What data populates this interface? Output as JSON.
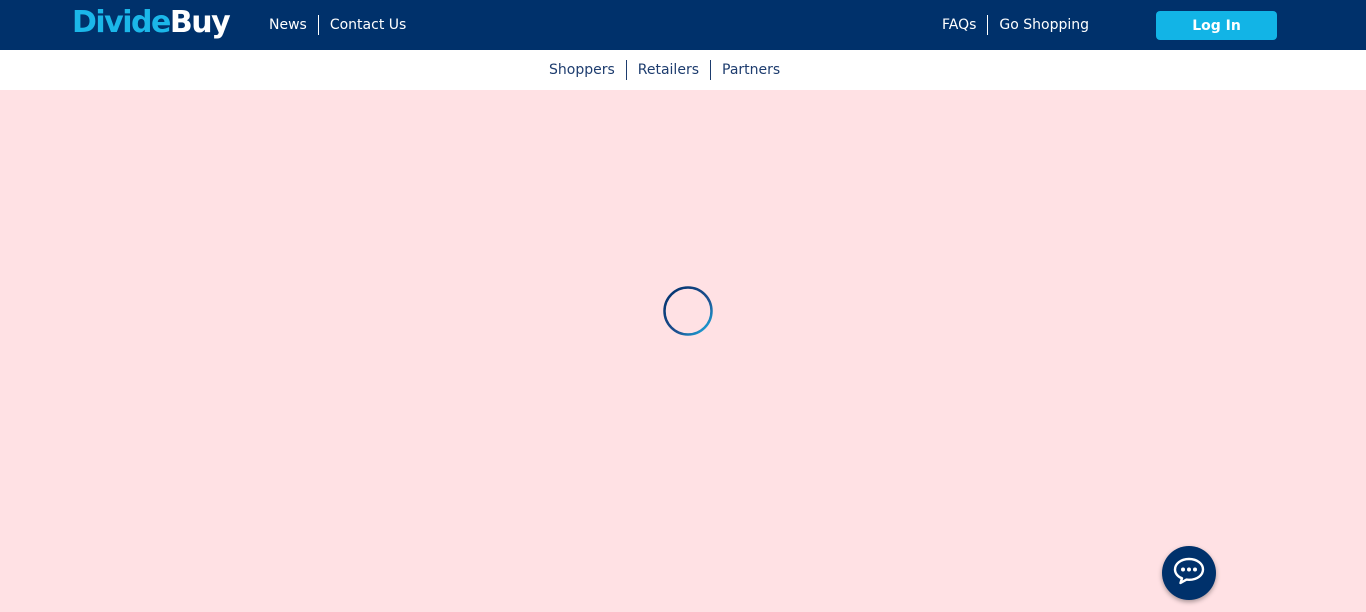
{
  "header": {
    "logo_part1": "Divide",
    "logo_part2": "Buy",
    "nav_left": [
      "News",
      "Contact Us"
    ],
    "nav_right": [
      "FAQs",
      "Go Shopping"
    ],
    "login_label": "Log In"
  },
  "subnav": {
    "items": [
      "Shoppers",
      "Retailers",
      "Partners"
    ]
  },
  "colors": {
    "header_bg": "#00316b",
    "brand_accent": "#1bb7e9",
    "page_bg": "#ffe1e4",
    "subnav_text": "#1d3c6e"
  },
  "icons": {
    "loading": "loading-spinner-icon",
    "chat": "chat-bubble-icon"
  }
}
